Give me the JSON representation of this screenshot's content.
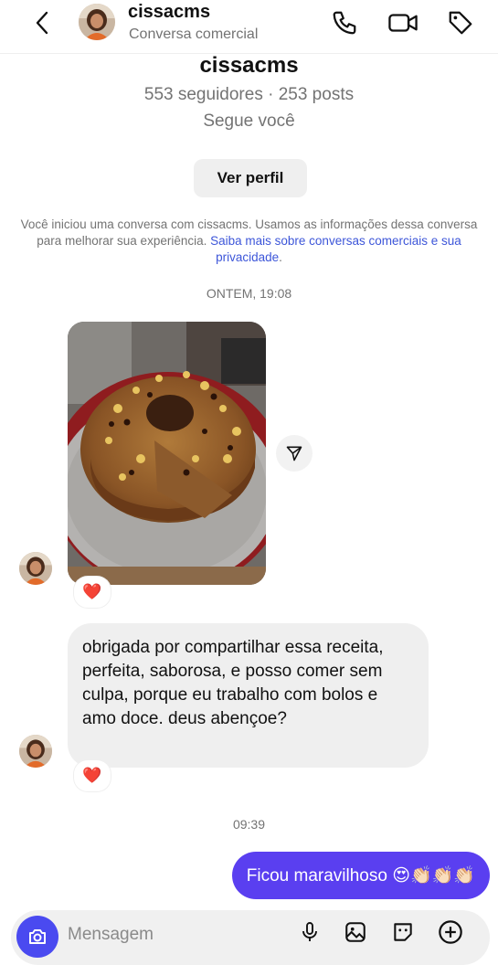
{
  "header": {
    "username": "cissacms",
    "subtitle": "Conversa comercial",
    "icons": [
      "back-arrow-icon",
      "phone-icon",
      "video-icon",
      "tag-icon"
    ]
  },
  "profile": {
    "name": "cissacms",
    "stats": "553 seguidores · 253 posts",
    "follows": "Segue você",
    "view_profile_label": "Ver perfil"
  },
  "notice": {
    "text": "Você iniciou uma conversa com cissacms. Usamos as informações dessa conversa para melhorar sua experiência.",
    "link": "Saiba mais sobre conversas comerciais e sua privacidade",
    "end": "."
  },
  "messages": {
    "timestamp_1": "ONTEM, 19:08",
    "photo_reaction": "❤️",
    "incoming_text": "obrigada por compartilhar essa receita, perfeita, saborosa, e posso comer sem culpa, porque eu trabalho com bolos e amo doce. deus abençoe?",
    "incoming_reaction": "❤️",
    "timestamp_2": "09:39",
    "outgoing_text": "Ficou maravilhoso 😍👏🏻👏🏻👏🏻"
  },
  "composer": {
    "placeholder": "Mensagem",
    "icons": [
      "camera-icon",
      "microphone-icon",
      "gallery-icon",
      "sticker-icon",
      "plus-icon"
    ]
  },
  "colors": {
    "accent": "#5a3ff0",
    "link": "#3d56d9",
    "muted": "#737373",
    "bubble_in": "#efefef"
  }
}
